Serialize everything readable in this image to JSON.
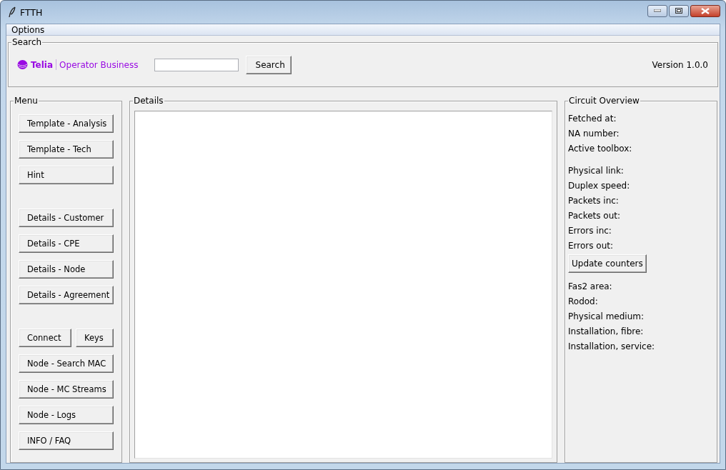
{
  "window": {
    "title": "FTTH"
  },
  "menubar": [
    "Options"
  ],
  "search": {
    "title": "Search",
    "logo": {
      "brand": "Telia",
      "product": "Operator Business"
    },
    "button": "Search",
    "version": "Version 1.0.0"
  },
  "menu": {
    "title": "Menu",
    "groups": [
      [
        [
          "Template - Analysis"
        ],
        [
          "Template - Tech"
        ],
        [
          "Hint"
        ]
      ],
      [
        [
          "Details - Customer"
        ],
        [
          "Details - CPE"
        ],
        [
          "Details - Node"
        ],
        [
          "Details - Agreement"
        ]
      ],
      [
        [
          "Connect",
          "Keys"
        ],
        [
          "Node - Search MAC"
        ],
        [
          "Node - MC Streams"
        ],
        [
          "Node - Logs"
        ],
        [
          "INFO / FAQ"
        ]
      ]
    ]
  },
  "details": {
    "title": "Details"
  },
  "circuit_overview": {
    "title": "Circuit Overview",
    "sections": [
      {
        "labels": [
          "Fetched at:",
          "NA number:",
          "Active toolbox:"
        ]
      },
      {
        "labels": [
          "Physical link:",
          "Duplex speed:",
          "Packets inc:",
          "Packets out:",
          "Errors inc:",
          "Errors out:"
        ],
        "button": "Update counters"
      },
      {
        "labels": [
          "Fas2 area:",
          "Rodod:",
          "Physical medium:",
          "Installation, fibre:",
          "Installation, service:"
        ]
      }
    ]
  }
}
